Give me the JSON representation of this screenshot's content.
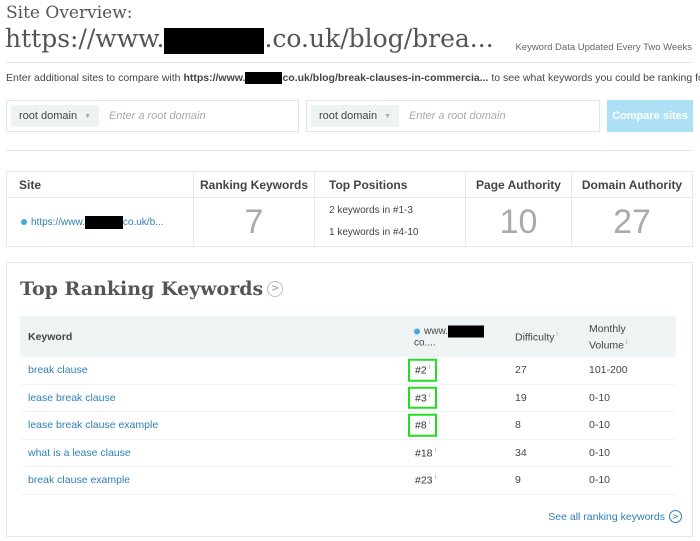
{
  "header": {
    "title": "Site Overview:",
    "url_prefix": "https://www.",
    "url_suffix": ".co.uk/blog/brea...",
    "updated": "Keyword Data Updated Every Two Weeks"
  },
  "compare": {
    "intro_pre": "Enter additional sites to compare with ",
    "intro_url_prefix": "https://www.",
    "intro_url_suffix": "co.uk/blog/break-clauses-in-commercia...",
    "intro_post": " to see what keywords you could be ranking for.",
    "fields": [
      {
        "select": "root domain",
        "placeholder": "Enter a root domain"
      },
      {
        "select": "root domain",
        "placeholder": "Enter a root domain"
      }
    ],
    "button": "Compare sites"
  },
  "metrics": {
    "headers": [
      "Site",
      "Ranking Keywords",
      "Top Positions",
      "Page Authority",
      "Domain Authority"
    ],
    "site_prefix": "https://www.",
    "site_suffix": "co.uk/b...",
    "ranking_keywords": "7",
    "top_positions": [
      "2 keywords in #1-3",
      "1 keywords in #4-10"
    ],
    "page_authority": "10",
    "domain_authority": "27"
  },
  "keywords": {
    "title": "Top Ranking Keywords",
    "headers": {
      "keyword": "Keyword",
      "site_prefix": "www.",
      "site_suffix": "co....",
      "difficulty": "Difficulty",
      "volume": "Monthly Volume"
    },
    "rows": [
      {
        "keyword": "break clause",
        "rank": "#2",
        "difficulty": "27",
        "volume": "101-200",
        "highlight": true
      },
      {
        "keyword": "lease break clause",
        "rank": "#3",
        "difficulty": "19",
        "volume": "0-10",
        "highlight": true
      },
      {
        "keyword": "lease break clause example",
        "rank": "#8",
        "difficulty": "8",
        "volume": "0-10",
        "highlight": true
      },
      {
        "keyword": "what is a lease clause",
        "rank": "#18",
        "difficulty": "34",
        "volume": "0-10",
        "highlight": false
      },
      {
        "keyword": "break clause example",
        "rank": "#23",
        "difficulty": "9",
        "volume": "0-10",
        "highlight": false
      }
    ],
    "see_all": "See all ranking keywords"
  },
  "colors": {
    "accent": "#2e7fb6",
    "button": "#aee0f5",
    "highlight": "#22dd22",
    "dot": "#4aa8e0"
  }
}
